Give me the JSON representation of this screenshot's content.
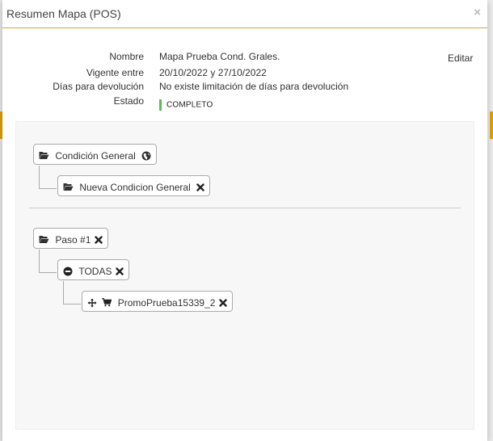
{
  "modal": {
    "title": "Resumen Mapa (POS)",
    "close_label": "×"
  },
  "summary": {
    "name_label": "Nombre",
    "name_value": "Mapa Prueba Cond. Grales.",
    "valid_label": "Vigente entre",
    "valid_value": "20/10/2022 y 27/10/2022",
    "days_label": "Días para devolución",
    "days_value": "No existe limitación de días para devolución",
    "status_label": "Estado",
    "status_value": "COMPLETO",
    "status_color": "#5cb85c",
    "edit_label": "Editar"
  },
  "tree": {
    "general": {
      "label": "Condición General",
      "icon": "folder-open-icon",
      "trailing_icon": "globe-icon",
      "children": [
        {
          "label": "Nueva Condicion General",
          "icon": "folder-open-icon",
          "trailing_icon": "remove-icon"
        }
      ]
    },
    "step": {
      "label": "Paso #1",
      "icon": "folder-open-icon",
      "trailing_icon": "remove-icon",
      "child": {
        "label": "TODAS",
        "icon": "minus-circle-icon",
        "trailing_icon": "remove-icon",
        "child": {
          "label": "PromoPrueba15339_2",
          "icons": [
            "move-icon",
            "cart-icon"
          ],
          "trailing_icon": "remove-icon"
        }
      }
    }
  },
  "colors": {
    "accent": "#e0a32a",
    "status": "#5cb85c",
    "node_border": "#aaaaaa"
  }
}
